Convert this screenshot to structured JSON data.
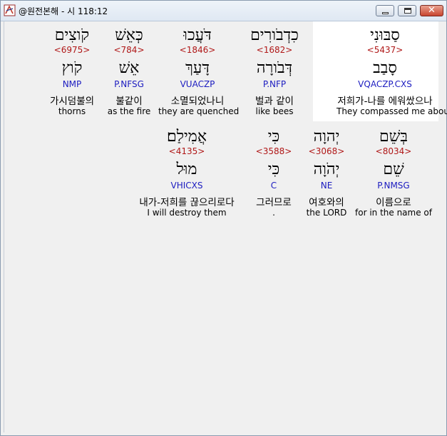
{
  "window": {
    "title": "@원전본해 - 시 118:12",
    "minimize_glyph": "",
    "maximize_glyph": "",
    "close_glyph": "✕"
  },
  "colors": {
    "strong_number": "#b01818",
    "morphology": "#1c1cc0",
    "selected_bg": "#ffffff"
  },
  "rows": [
    {
      "words": [
        {
          "hebrew": "סַבּוּנִי",
          "strong": "<5437>",
          "root": "סָבַב",
          "morph": "VQACZP.CXS",
          "korean": "저희가-나를 에워쌌으나",
          "english": "They compassed me about",
          "selected": true
        },
        {
          "hebrew": "כִדְבֹורִים",
          "strong": "<1682>",
          "root": "דְּבֹורָה",
          "morph": "P.NFP",
          "korean": "벌과 같이",
          "english": "like bees"
        },
        {
          "hebrew": "דֹּעֲכוּ",
          "strong": "<1846>",
          "root": "דָּעַךְ",
          "morph": "VUACZP",
          "korean": "소멸되었나니",
          "english": "they are quenched"
        },
        {
          "hebrew": "כְּאֵשׁ",
          "strong": "<784>",
          "root": "אֵשׁ",
          "morph": "P.NFSG",
          "korean": "불같이",
          "english": "as the fire"
        },
        {
          "hebrew": "קֹוצִים",
          "strong": "<6975>",
          "root": "קֹוץ",
          "morph": "NMP",
          "korean": "가시덤불의",
          "english": "thorns"
        }
      ]
    },
    {
      "words": [
        {
          "hebrew": "בְּשֵׁם",
          "strong": "<8034>",
          "root": "שֵׁם",
          "morph": "P.NMSG",
          "korean": "이름으로",
          "english": "for in the name of"
        },
        {
          "hebrew": "יְהוָה",
          "strong": "<3068>",
          "root": "יְהֹוָה",
          "morph": "NE",
          "korean": "여호와의",
          "english": "the LORD"
        },
        {
          "hebrew": "כִּי",
          "strong": "<3588>",
          "root": "כִּי",
          "morph": "C",
          "korean": "그러므로",
          "english": "."
        },
        {
          "hebrew": "אֲמִילַם׃",
          "strong": "<4135>",
          "root": "מוּל",
          "morph": "VHICXS",
          "korean": "내가-저희를 끊으리로다",
          "english": "I will destroy them"
        }
      ]
    }
  ]
}
